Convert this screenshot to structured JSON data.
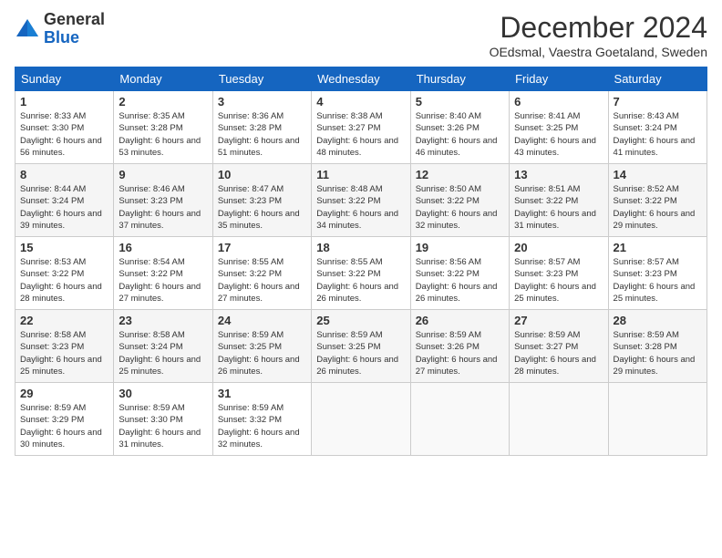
{
  "header": {
    "logo": {
      "line1": "General",
      "line2": "Blue"
    },
    "title": "December 2024",
    "subtitle": "OEdsmal, Vaestra Goetaland, Sweden"
  },
  "days_of_week": [
    "Sunday",
    "Monday",
    "Tuesday",
    "Wednesday",
    "Thursday",
    "Friday",
    "Saturday"
  ],
  "weeks": [
    [
      {
        "day": "1",
        "sunrise": "Sunrise: 8:33 AM",
        "sunset": "Sunset: 3:30 PM",
        "daylight": "Daylight: 6 hours and 56 minutes."
      },
      {
        "day": "2",
        "sunrise": "Sunrise: 8:35 AM",
        "sunset": "Sunset: 3:28 PM",
        "daylight": "Daylight: 6 hours and 53 minutes."
      },
      {
        "day": "3",
        "sunrise": "Sunrise: 8:36 AM",
        "sunset": "Sunset: 3:28 PM",
        "daylight": "Daylight: 6 hours and 51 minutes."
      },
      {
        "day": "4",
        "sunrise": "Sunrise: 8:38 AM",
        "sunset": "Sunset: 3:27 PM",
        "daylight": "Daylight: 6 hours and 48 minutes."
      },
      {
        "day": "5",
        "sunrise": "Sunrise: 8:40 AM",
        "sunset": "Sunset: 3:26 PM",
        "daylight": "Daylight: 6 hours and 46 minutes."
      },
      {
        "day": "6",
        "sunrise": "Sunrise: 8:41 AM",
        "sunset": "Sunset: 3:25 PM",
        "daylight": "Daylight: 6 hours and 43 minutes."
      },
      {
        "day": "7",
        "sunrise": "Sunrise: 8:43 AM",
        "sunset": "Sunset: 3:24 PM",
        "daylight": "Daylight: 6 hours and 41 minutes."
      }
    ],
    [
      {
        "day": "8",
        "sunrise": "Sunrise: 8:44 AM",
        "sunset": "Sunset: 3:24 PM",
        "daylight": "Daylight: 6 hours and 39 minutes."
      },
      {
        "day": "9",
        "sunrise": "Sunrise: 8:46 AM",
        "sunset": "Sunset: 3:23 PM",
        "daylight": "Daylight: 6 hours and 37 minutes."
      },
      {
        "day": "10",
        "sunrise": "Sunrise: 8:47 AM",
        "sunset": "Sunset: 3:23 PM",
        "daylight": "Daylight: 6 hours and 35 minutes."
      },
      {
        "day": "11",
        "sunrise": "Sunrise: 8:48 AM",
        "sunset": "Sunset: 3:22 PM",
        "daylight": "Daylight: 6 hours and 34 minutes."
      },
      {
        "day": "12",
        "sunrise": "Sunrise: 8:50 AM",
        "sunset": "Sunset: 3:22 PM",
        "daylight": "Daylight: 6 hours and 32 minutes."
      },
      {
        "day": "13",
        "sunrise": "Sunrise: 8:51 AM",
        "sunset": "Sunset: 3:22 PM",
        "daylight": "Daylight: 6 hours and 31 minutes."
      },
      {
        "day": "14",
        "sunrise": "Sunrise: 8:52 AM",
        "sunset": "Sunset: 3:22 PM",
        "daylight": "Daylight: 6 hours and 29 minutes."
      }
    ],
    [
      {
        "day": "15",
        "sunrise": "Sunrise: 8:53 AM",
        "sunset": "Sunset: 3:22 PM",
        "daylight": "Daylight: 6 hours and 28 minutes."
      },
      {
        "day": "16",
        "sunrise": "Sunrise: 8:54 AM",
        "sunset": "Sunset: 3:22 PM",
        "daylight": "Daylight: 6 hours and 27 minutes."
      },
      {
        "day": "17",
        "sunrise": "Sunrise: 8:55 AM",
        "sunset": "Sunset: 3:22 PM",
        "daylight": "Daylight: 6 hours and 27 minutes."
      },
      {
        "day": "18",
        "sunrise": "Sunrise: 8:55 AM",
        "sunset": "Sunset: 3:22 PM",
        "daylight": "Daylight: 6 hours and 26 minutes."
      },
      {
        "day": "19",
        "sunrise": "Sunrise: 8:56 AM",
        "sunset": "Sunset: 3:22 PM",
        "daylight": "Daylight: 6 hours and 26 minutes."
      },
      {
        "day": "20",
        "sunrise": "Sunrise: 8:57 AM",
        "sunset": "Sunset: 3:23 PM",
        "daylight": "Daylight: 6 hours and 25 minutes."
      },
      {
        "day": "21",
        "sunrise": "Sunrise: 8:57 AM",
        "sunset": "Sunset: 3:23 PM",
        "daylight": "Daylight: 6 hours and 25 minutes."
      }
    ],
    [
      {
        "day": "22",
        "sunrise": "Sunrise: 8:58 AM",
        "sunset": "Sunset: 3:23 PM",
        "daylight": "Daylight: 6 hours and 25 minutes."
      },
      {
        "day": "23",
        "sunrise": "Sunrise: 8:58 AM",
        "sunset": "Sunset: 3:24 PM",
        "daylight": "Daylight: 6 hours and 25 minutes."
      },
      {
        "day": "24",
        "sunrise": "Sunrise: 8:59 AM",
        "sunset": "Sunset: 3:25 PM",
        "daylight": "Daylight: 6 hours and 26 minutes."
      },
      {
        "day": "25",
        "sunrise": "Sunrise: 8:59 AM",
        "sunset": "Sunset: 3:25 PM",
        "daylight": "Daylight: 6 hours and 26 minutes."
      },
      {
        "day": "26",
        "sunrise": "Sunrise: 8:59 AM",
        "sunset": "Sunset: 3:26 PM",
        "daylight": "Daylight: 6 hours and 27 minutes."
      },
      {
        "day": "27",
        "sunrise": "Sunrise: 8:59 AM",
        "sunset": "Sunset: 3:27 PM",
        "daylight": "Daylight: 6 hours and 28 minutes."
      },
      {
        "day": "28",
        "sunrise": "Sunrise: 8:59 AM",
        "sunset": "Sunset: 3:28 PM",
        "daylight": "Daylight: 6 hours and 29 minutes."
      }
    ],
    [
      {
        "day": "29",
        "sunrise": "Sunrise: 8:59 AM",
        "sunset": "Sunset: 3:29 PM",
        "daylight": "Daylight: 6 hours and 30 minutes."
      },
      {
        "day": "30",
        "sunrise": "Sunrise: 8:59 AM",
        "sunset": "Sunset: 3:30 PM",
        "daylight": "Daylight: 6 hours and 31 minutes."
      },
      {
        "day": "31",
        "sunrise": "Sunrise: 8:59 AM",
        "sunset": "Sunset: 3:32 PM",
        "daylight": "Daylight: 6 hours and 32 minutes."
      },
      null,
      null,
      null,
      null
    ]
  ]
}
